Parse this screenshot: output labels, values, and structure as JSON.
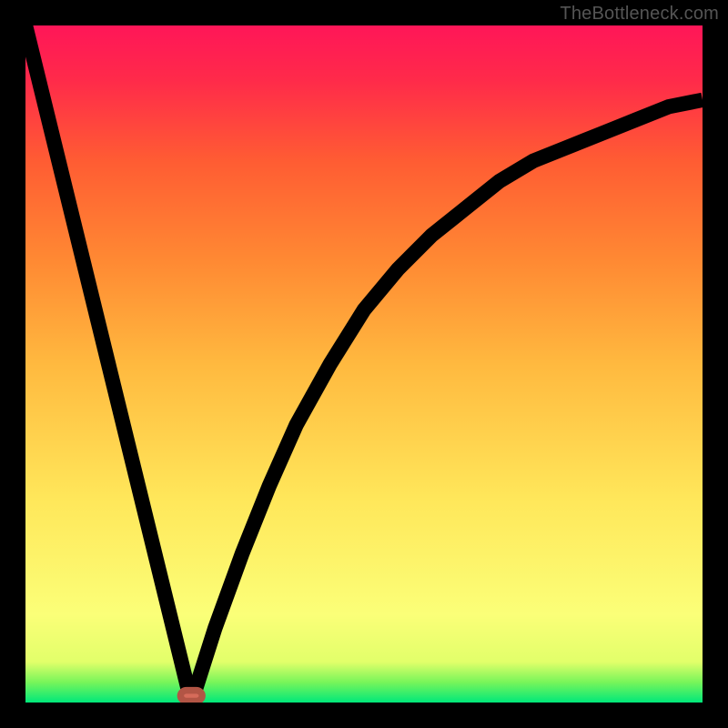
{
  "watermark": "TheBottleneck.com",
  "chart_data": {
    "type": "line",
    "title": "",
    "xlabel": "",
    "ylabel": "",
    "xlim": [
      0,
      100
    ],
    "ylim": [
      0,
      100
    ],
    "background_gradient": {
      "direction": "vertical",
      "stops": [
        {
          "pos": 0,
          "color": "#00e87a"
        },
        {
          "pos": 3,
          "color": "#78f55a"
        },
        {
          "pos": 6,
          "color": "#e2ff6a"
        },
        {
          "pos": 13,
          "color": "#fbff78"
        },
        {
          "pos": 30,
          "color": "#ffe75a"
        },
        {
          "pos": 50,
          "color": "#ffb93f"
        },
        {
          "pos": 65,
          "color": "#ff8a33"
        },
        {
          "pos": 80,
          "color": "#ff5c33"
        },
        {
          "pos": 92,
          "color": "#ff2a4a"
        },
        {
          "pos": 100,
          "color": "#ff1658"
        }
      ]
    },
    "series": [
      {
        "name": "left-slope",
        "x": [
          0,
          24.5
        ],
        "y": [
          100,
          0
        ]
      },
      {
        "name": "right-curve",
        "x": [
          24.5,
          28,
          32,
          36,
          40,
          45,
          50,
          55,
          60,
          65,
          70,
          75,
          80,
          85,
          90,
          95,
          100
        ],
        "y": [
          0,
          11,
          22,
          32,
          41,
          50,
          58,
          64,
          69,
          73,
          77,
          80,
          82,
          84,
          86,
          88,
          89
        ]
      }
    ],
    "marker": {
      "x": 24.5,
      "y": 1,
      "shape": "rounded-rect",
      "color": "#d66b5a"
    }
  }
}
